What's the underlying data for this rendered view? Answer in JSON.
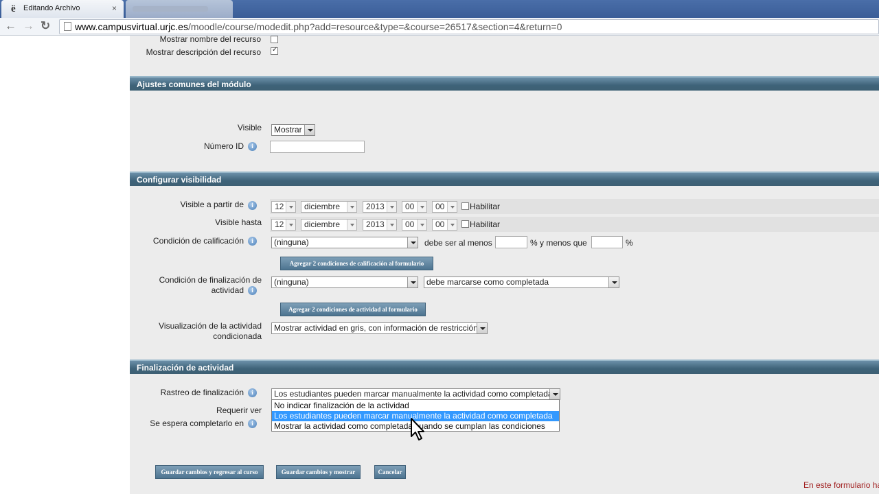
{
  "browser": {
    "active_tab_title": "Editando Archivo",
    "active_tab_icon": "e-icon",
    "tab_close": "×",
    "url_host": "www.campusvirtual.urjc.es",
    "url_path": "/moodle/course/modedit.php?add=resource&type=&course=26517&section=4&return=0",
    "back_icon": "←",
    "forward_icon": "→",
    "reload_icon": "↻"
  },
  "top_section": {
    "show_name_label": "Mostrar nombre del recurso",
    "show_name_checked": false,
    "show_desc_label": "Mostrar descripción del recurso",
    "show_desc_checked": true
  },
  "module_common": {
    "header": "Ajustes comunes del módulo",
    "visible_label": "Visible",
    "visible_value": "Mostrar",
    "id_label": "Número ID",
    "id_value": ""
  },
  "visibility": {
    "header": "Configurar visibilidad",
    "from_label": "Visible a partir de",
    "until_label": "Visible hasta",
    "from": {
      "day": "12",
      "month": "diciembre",
      "year": "2013",
      "hour": "00",
      "minute": "00",
      "enable_label": "Habilitar",
      "enabled": false
    },
    "until": {
      "day": "12",
      "month": "diciembre",
      "year": "2013",
      "hour": "00",
      "minute": "00",
      "enable_label": "Habilitar",
      "enabled": false
    },
    "grade_cond_label": "Condición de calificación",
    "grade_cond_value": "(ninguna)",
    "must_be_at_least": "debe ser al menos",
    "pct_and_less_than": "% y menos que",
    "pct": "%",
    "add_grade_btn": "Agregar 2 condiciones de calificación al formulario",
    "activity_cond_label_1": "Condición de finalización de",
    "activity_cond_label_2": "actividad",
    "activity_cond_value": "(ninguna)",
    "activity_cond_state": "debe marcarse como completada",
    "add_activity_btn": "Agregar 2 condiciones de actividad al formulario",
    "display_label_1": "Visualización de la actividad",
    "display_label_2": "condicionada",
    "display_value": "Mostrar actividad en gris, con información de restricción"
  },
  "completion": {
    "header": "Finalización de actividad",
    "tracking_label": "Rastreo de finalización",
    "tracking_value": "Los estudiantes pueden marcar manualmente la actividad como completada",
    "require_view_label": "Requerir ver",
    "expected_label": "Se espera completarlo en",
    "options": [
      "No indicar finalización de la actividad",
      "Los estudiantes pueden marcar manualmente la actividad como completada",
      "Mostrar la actividad como completada cuando se cumplan las condiciones"
    ],
    "highlighted_index": 1
  },
  "footer": {
    "save_return": "Guardar cambios y regresar al curso",
    "save_show": "Guardar cambios y mostrar",
    "cancel": "Cancelar",
    "note": "En este formulario ha"
  }
}
